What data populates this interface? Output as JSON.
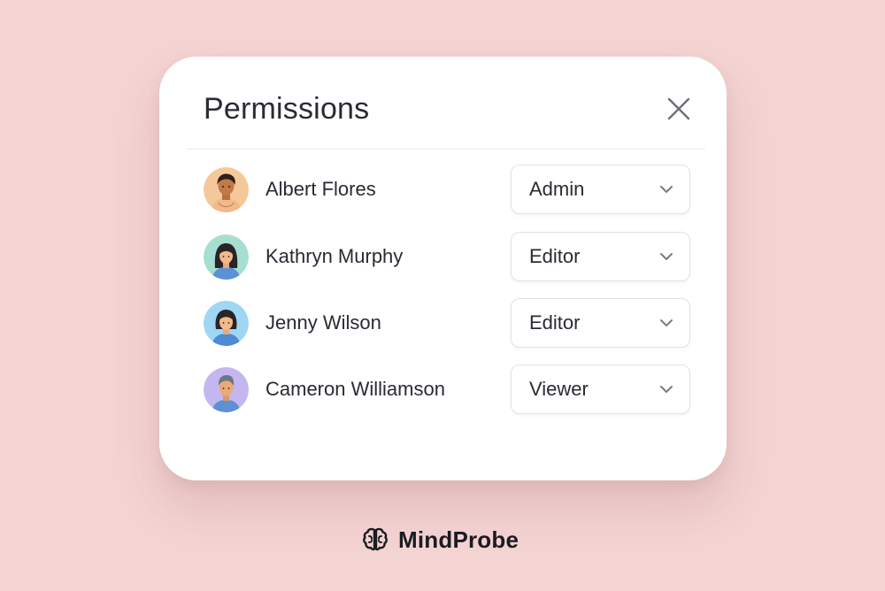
{
  "dialog": {
    "title": "Permissions",
    "close_icon": "close-icon"
  },
  "users": [
    {
      "name": "Albert Flores",
      "role": "Admin",
      "avatar_bg": "#f5c89a"
    },
    {
      "name": "Kathryn Murphy",
      "role": "Editor",
      "avatar_bg": "#a6dfd0"
    },
    {
      "name": "Jenny Wilson",
      "role": "Editor",
      "avatar_bg": "#9fd6f4"
    },
    {
      "name": "Cameron Williamson",
      "role": "Viewer",
      "avatar_bg": "#c4b7f0"
    }
  ],
  "role_select_icon": "chevron-down-icon",
  "brand": {
    "name": "MindProbe",
    "logo_icon": "brain-icon"
  },
  "colors": {
    "background": "#f4d3d3",
    "card": "#ffffff",
    "text": "#2a2b33"
  }
}
